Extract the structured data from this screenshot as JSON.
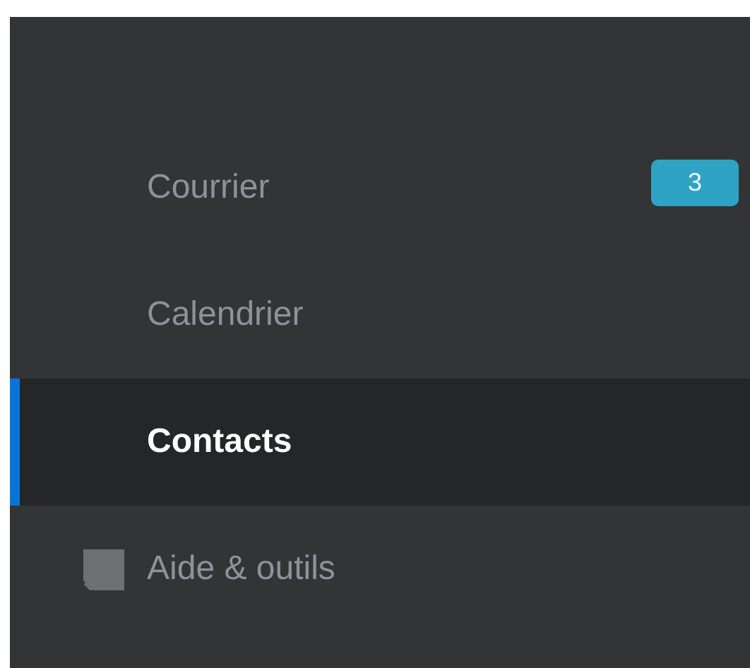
{
  "nav": {
    "items": [
      {
        "label": "Courrier",
        "selected": false,
        "badge": "3",
        "icon": false
      },
      {
        "label": "Calendrier",
        "selected": false,
        "icon": false
      },
      {
        "label": "Contacts",
        "selected": true,
        "icon": false
      },
      {
        "label": "Aide & outils",
        "selected": false,
        "icon": true
      }
    ]
  }
}
